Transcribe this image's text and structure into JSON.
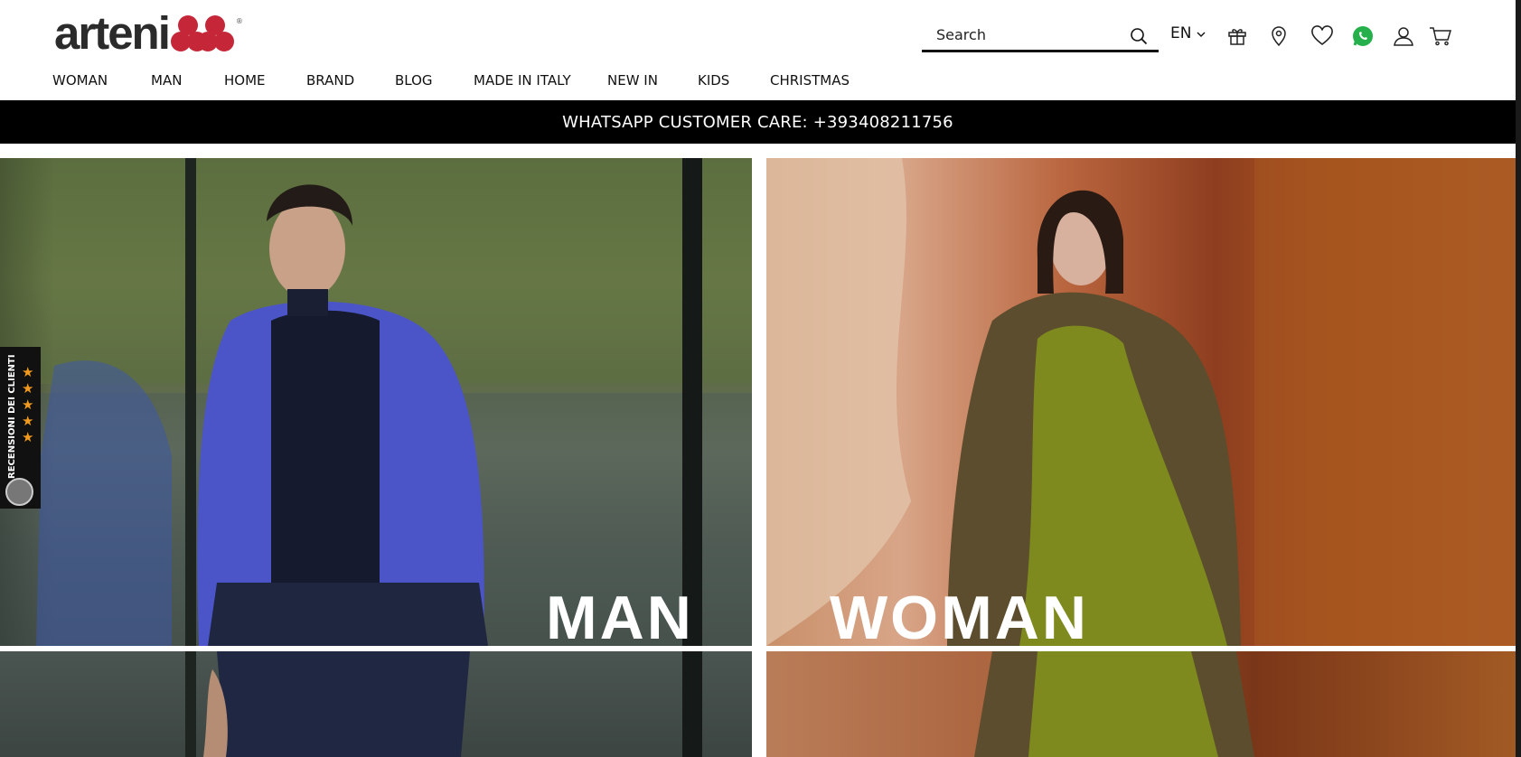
{
  "header": {
    "logo_text": "arteni",
    "logo_reg": "®",
    "search": {
      "placeholder": "Search"
    },
    "language": "EN",
    "icons": [
      "gift-icon",
      "location-pin-icon",
      "heart-icon",
      "whatsapp-icon",
      "user-icon",
      "cart-icon"
    ]
  },
  "nav": {
    "items": [
      {
        "label": "WOMAN"
      },
      {
        "label": "MAN"
      },
      {
        "label": "HOME"
      },
      {
        "label": "BRAND"
      },
      {
        "label": "BLOG"
      },
      {
        "label": "MADE IN ITALY"
      },
      {
        "label": "NEW IN"
      },
      {
        "label": "KIDS"
      },
      {
        "label": "CHRISTMAS"
      }
    ]
  },
  "banner": {
    "text": "WHATSAPP CUSTOMER CARE: +393408211756"
  },
  "tiles": {
    "man": {
      "label": "MAN"
    },
    "woman": {
      "label": "WOMAN"
    }
  },
  "reviews": {
    "label": "RECENSIONI DEI CLIENTI",
    "stars": 5
  },
  "colors": {
    "brand_red": "#c52738",
    "banner_bg": "#000000",
    "whatsapp_green": "#25b04b",
    "star": "#f29a1f"
  }
}
